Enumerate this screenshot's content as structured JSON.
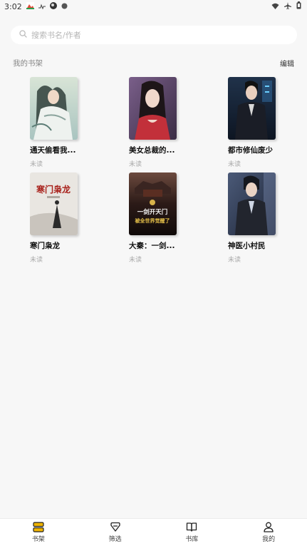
{
  "status_bar": {
    "time": "3:02",
    "icons": [
      "photos-icon",
      "activity-icon",
      "app-icon",
      "dot-icon",
      "wifi-icon",
      "airplane-icon",
      "battery-icon"
    ]
  },
  "search": {
    "placeholder": "搜索书名/作者"
  },
  "shelf": {
    "title": "我的书架",
    "edit_label": "编辑",
    "books": [
      {
        "title": "通天偷看我...",
        "status": "未读"
      },
      {
        "title": "美女总裁的...",
        "status": "未读"
      },
      {
        "title": "都市修仙废少",
        "status": "未读"
      },
      {
        "title": "寒门枭龙",
        "status": "未读"
      },
      {
        "title": "大秦：一剑...",
        "status": "未读"
      },
      {
        "title": "神医小村民",
        "status": "未读"
      }
    ],
    "cover_texts": {
      "book4": "寒门枭龙",
      "book5_line1": "一剑开天门",
      "book5_line2": "被全世界觉醒了"
    }
  },
  "bottom_nav": {
    "items": [
      {
        "label": "书架",
        "icon": "bookshelf-icon",
        "active": true
      },
      {
        "label": "筛选",
        "icon": "filter-icon",
        "active": false
      },
      {
        "label": "书库",
        "icon": "open-book-icon",
        "active": false
      },
      {
        "label": "我的",
        "icon": "user-icon",
        "active": false
      }
    ]
  },
  "colors": {
    "accent": "#f0b400",
    "background": "#f7f7f7"
  }
}
